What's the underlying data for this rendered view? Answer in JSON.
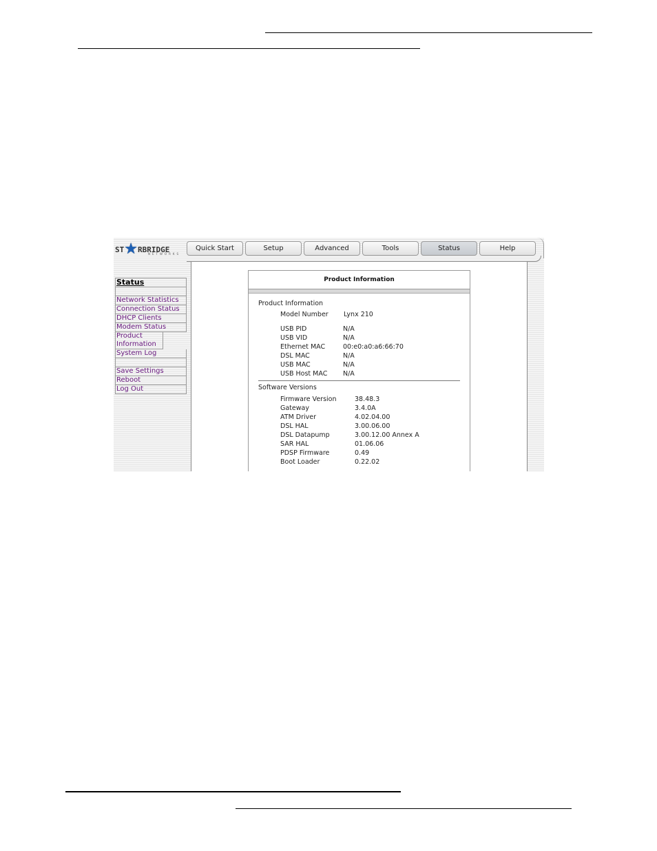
{
  "app": {
    "logo": {
      "left": "ST",
      "right": "RBRIDGE",
      "sub": "NETWORKS",
      "star_icon": "star-icon"
    }
  },
  "tabs": [
    {
      "label": "Quick Start",
      "active": false
    },
    {
      "label": "Setup",
      "active": false
    },
    {
      "label": "Advanced",
      "active": false
    },
    {
      "label": "Tools",
      "active": false
    },
    {
      "label": "Status",
      "active": true
    },
    {
      "label": "Help",
      "active": false
    }
  ],
  "sidebar": {
    "heading": "Status",
    "items": [
      "Network Statistics",
      "Connection Status",
      "DHCP Clients",
      "Modem Status",
      "Product Information",
      "System Log"
    ],
    "actions": [
      "Save Settings",
      "Reboot",
      "Log Out"
    ]
  },
  "panel": {
    "title": "Product Information",
    "product_section": "Product Information",
    "model": {
      "label": "Model Number",
      "value": "Lynx 210"
    },
    "product_rows": [
      {
        "label": "USB PID",
        "value": "N/A"
      },
      {
        "label": "USB VID",
        "value": "N/A"
      },
      {
        "label": "Ethernet MAC",
        "value": "00:e0:a0:a6:66:70"
      },
      {
        "label": "DSL MAC",
        "value": "N/A"
      },
      {
        "label": "USB MAC",
        "value": "N/A"
      },
      {
        "label": "USB Host MAC",
        "value": "N/A"
      }
    ],
    "software_section": "Software Versions",
    "software_rows": [
      {
        "label": "Firmware Version",
        "value": "38.48.3"
      },
      {
        "label": "Gateway",
        "value": "3.4.0A"
      },
      {
        "label": "ATM Driver",
        "value": "4.02.04.00"
      },
      {
        "label": "DSL HAL",
        "value": "3.00.06.00"
      },
      {
        "label": "DSL Datapump",
        "value": "3.00.12.00 Annex A"
      },
      {
        "label": "SAR HAL",
        "value": "01.06.06"
      },
      {
        "label": "PDSP Firmware",
        "value": "0.49"
      },
      {
        "label": "Boot Loader",
        "value": "0.22.02"
      }
    ]
  }
}
